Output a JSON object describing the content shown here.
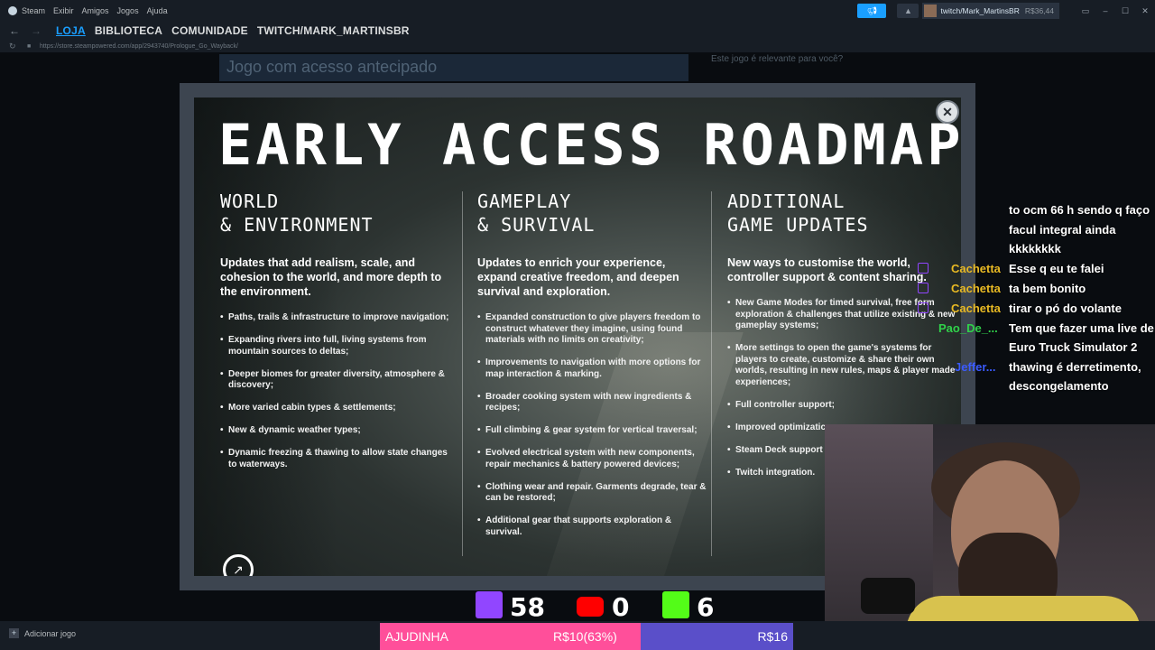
{
  "titlebar": {
    "app_name": "Steam",
    "menu": [
      "Exibir",
      "Amigos",
      "Jogos",
      "Ajuda"
    ],
    "user_name": "twitch/Mark_MartinsBR",
    "balance": "R$36,44"
  },
  "nav": {
    "tabs": [
      "LOJA",
      "BIBLIOTECA",
      "COMUNIDADE",
      "TWITCH/MARK_MARTINSBR"
    ],
    "active_tab": "LOJA",
    "url": "https://store.steampowered.com/app/2943740/Prologue_Go_Wayback/"
  },
  "store": {
    "early_access_banner": "Jogo com acesso antecipado",
    "relevance_prompt": "Este jogo é relevante para você?"
  },
  "roadmap": {
    "title": "EARLY ACCESS ROADMAP",
    "columns": [
      {
        "heading": "WORLD\n& ENVIRONMENT",
        "intro": "Updates that add realism, scale, and cohesion to the world, and more depth to the environment.",
        "items": [
          "Paths, trails & infrastructure to improve navigation;",
          "Expanding rivers into full, living systems from mountain sources to deltas;",
          "Deeper biomes for greater diversity, atmosphere & discovery;",
          "More varied cabin types & settlements;",
          "New & dynamic weather types;",
          "Dynamic freezing & thawing to allow state changes to waterways."
        ]
      },
      {
        "heading": "GAMEPLAY\n& SURVIVAL",
        "intro": "Updates to enrich your experience, expand creative freedom, and deepen survival and exploration.",
        "items": [
          "Expanded construction to give players freedom to construct whatever they imagine, using found materials with no limits on creativity;",
          "Improvements to navigation with more options for map interaction & marking.",
          "Broader cooking system with new ingredients & recipes;",
          "Full climbing & gear system for vertical traversal;",
          "Evolved electrical system with new components, repair mechanics & battery powered devices;",
          "Clothing wear and repair. Garments degrade, tear & can be restored;",
          "Additional gear that supports exploration & survival."
        ]
      },
      {
        "heading": "ADDITIONAL\nGAME UPDATES",
        "intro": "New ways to customise the world, controller support & content sharing.",
        "items": [
          "New Game Modes for timed survival, free form exploration & challenges that utilize existing & new gameplay systems;",
          "More settings to open the game's systems for players to create, customize & share their own worlds, resulting in new rules, maps & player made experiences;",
          "Full controller support;",
          "Improved optimizatic",
          "Steam Deck support",
          "Twitch integration."
        ]
      }
    ]
  },
  "chat": {
    "lines": [
      {
        "user": "",
        "text": "to ocm 66 h sendo q faço"
      },
      {
        "user": "",
        "text": "facul integral ainda"
      },
      {
        "user": "",
        "text": "kkkkkkkk"
      },
      {
        "user": "Cachetta",
        "text": "Esse q eu te falei"
      },
      {
        "user": "Cachetta",
        "text": "ta bem bonito"
      },
      {
        "user": "Cachetta",
        "text": "tirar o pó do volante"
      },
      {
        "user": "Pao_De_...",
        "text": "Tem que fazer uma live de"
      },
      {
        "user": "",
        "text": "Euro Truck Simulator 2"
      },
      {
        "user": "Jeffer...",
        "text": "thawing é derretimento,"
      },
      {
        "user": "",
        "text": "descongelamento"
      }
    ],
    "colors": {
      "cachetta": "#e8b923",
      "pao": "#30d14a",
      "jeffer": "#3b5bff",
      "badge": "#9146ff"
    }
  },
  "counters": {
    "twitch": "58",
    "youtube": "0",
    "kick": "6",
    "colors": {
      "twitch": "#9146ff",
      "youtube": "#ff0000",
      "kick": "#53fc18"
    }
  },
  "bottombar": {
    "add_game": "Adicionar jogo",
    "goal_label": "AJUDINHA",
    "goal_progress": "R$10(63%)",
    "goal_progress_fraction": 0.63,
    "goal_target": "R$16"
  }
}
